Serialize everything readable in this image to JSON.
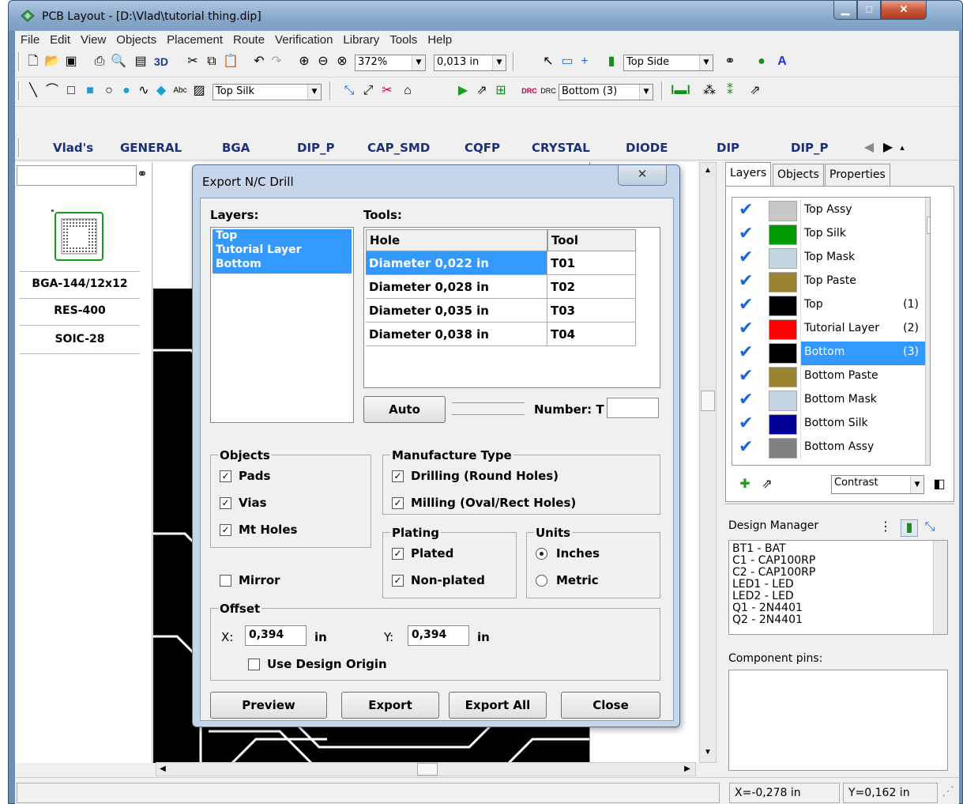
{
  "window": {
    "title": "PCB Layout - [D:\\Vlad\\tutorial thing.dip]"
  },
  "menu": [
    "File",
    "Edit",
    "View",
    "Objects",
    "Placement",
    "Route",
    "Verification",
    "Library",
    "Tools",
    "Help"
  ],
  "toolbar1": {
    "zoom": "372%",
    "grid": "0,013 in",
    "side": "Top Side"
  },
  "toolbar2": {
    "layer": "Top Silk",
    "route_layer": "Bottom (3)"
  },
  "library_tabs": [
    "Vlad's",
    "GENERAL",
    "BGA",
    "DIP_P",
    "CAP_SMD",
    "CQFP",
    "CRYSTAL",
    "DIODE",
    "DIP",
    "DIP_P"
  ],
  "parts": [
    "BGA-144/12x12",
    "RES-400",
    "SOIC-28"
  ],
  "right_tabs": [
    "Layers",
    "Objects",
    "Properties"
  ],
  "layers": [
    {
      "name": "Top Assy",
      "color": "#c8c8c8",
      "num": ""
    },
    {
      "name": "Top Silk",
      "color": "#009900",
      "num": ""
    },
    {
      "name": "Top Mask",
      "color": "#c4d4e0",
      "num": ""
    },
    {
      "name": "Top Paste",
      "color": "#9a8430",
      "num": ""
    },
    {
      "name": "Top",
      "color": "#000000",
      "num": "(1)"
    },
    {
      "name": "Tutorial Layer",
      "color": "#ff0000",
      "num": "(2)"
    },
    {
      "name": "Bottom",
      "color": "#000000",
      "num": "(3)"
    },
    {
      "name": "Bottom Paste",
      "color": "#9a8430",
      "num": ""
    },
    {
      "name": "Bottom Mask",
      "color": "#c4d4e0",
      "num": ""
    },
    {
      "name": "Bottom Silk",
      "color": "#000099",
      "num": ""
    },
    {
      "name": "Bottom Assy",
      "color": "#808080",
      "num": ""
    }
  ],
  "contrast": "Contrast",
  "design_manager": {
    "title": "Design Manager",
    "items": [
      "BT1 - BAT",
      "C1 - CAP100RP",
      "C2 - CAP100RP",
      "LED1 - LED",
      "LED2 - LED",
      "Q1 - 2N4401",
      "Q2 - 2N4401"
    ],
    "pins_label": "Component pins:"
  },
  "status": {
    "x": "X=-0,278 in",
    "y": "Y=0,162 in"
  },
  "dialog": {
    "title": "Export N/C Drill",
    "layers_label": "Layers:",
    "layers": [
      "Top",
      "Tutorial Layer",
      "Bottom"
    ],
    "tools_label": "Tools:",
    "columns": [
      "Hole",
      "Tool"
    ],
    "rows": [
      [
        "Diameter 0,022 in",
        "T01"
      ],
      [
        "Diameter 0,028 in",
        "T02"
      ],
      [
        "Diameter 0,035 in",
        "T03"
      ],
      [
        "Diameter 0,038 in",
        "T04"
      ]
    ],
    "auto": "Auto",
    "number_label": "Number: T",
    "number_value": "",
    "objects": {
      "title": "Objects",
      "pads": "Pads",
      "vias": "Vias",
      "mt_holes": "Mt Holes"
    },
    "manufacture": {
      "title": "Manufacture Type",
      "drilling": "Drilling (Round Holes)",
      "milling": "Milling (Oval/Rect Holes)"
    },
    "plating": {
      "title": "Plating",
      "plated": "Plated",
      "nonplated": "Non-plated"
    },
    "units": {
      "title": "Units",
      "inches": "Inches",
      "metric": "Metric"
    },
    "mirror": "Mirror",
    "offset": {
      "title": "Offset",
      "x_label": "X:",
      "x": "0,394",
      "y_label": "Y:",
      "y": "0,394",
      "unit": "in",
      "use_origin": "Use Design Origin"
    },
    "buttons": {
      "preview": "Preview",
      "export": "Export",
      "export_all": "Export All",
      "close": "Close"
    },
    "close_glyph": "✕"
  }
}
